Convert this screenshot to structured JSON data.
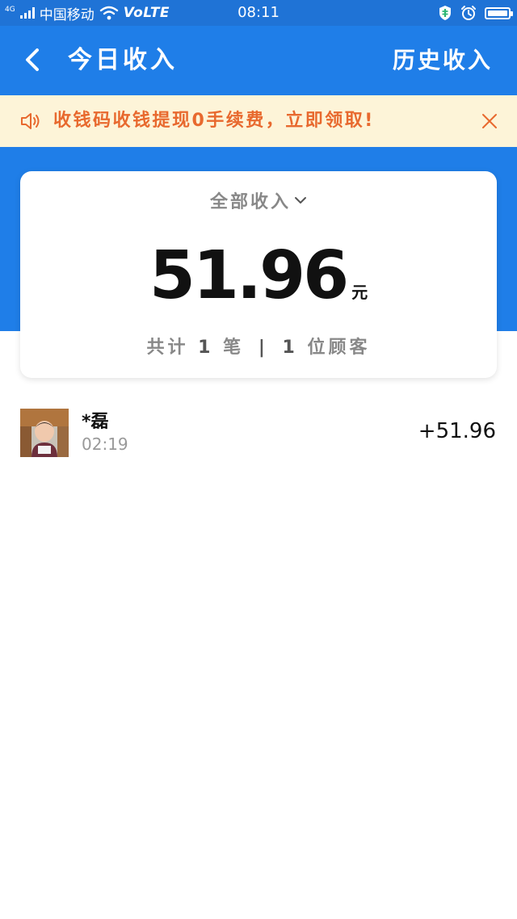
{
  "status_bar": {
    "network": "4G",
    "carrier": "中国移动",
    "volte": "VoLTE",
    "time": "08:11"
  },
  "header": {
    "title": "今日收入",
    "history_label": "历史收入"
  },
  "notice": {
    "text": "收钱码收钱提现0手续费，立即领取!"
  },
  "summary": {
    "filter_label": "全部收入",
    "amount": "51.96",
    "currency": "元",
    "stats": {
      "prefix": "共计",
      "count": "1",
      "count_unit": "笔",
      "separator": "|",
      "customers": "1",
      "customers_unit": "位顾客"
    }
  },
  "transactions": [
    {
      "name": "*磊",
      "time": "02:19",
      "amount": "+51.96"
    }
  ],
  "colors": {
    "header_bg": "#1f7ee8",
    "status_bg": "#1f73d6",
    "notice_bg": "#fdf4d8",
    "notice_text": "#e8692e"
  }
}
